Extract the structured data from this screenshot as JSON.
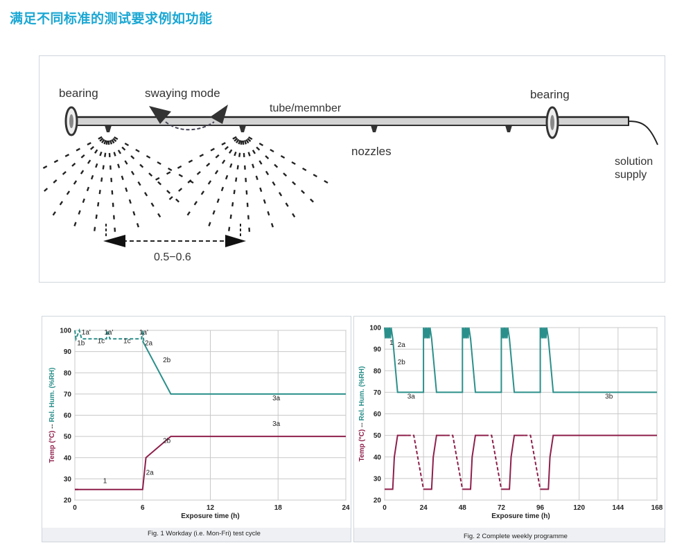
{
  "heading": "满足不同标准的测试要求例如功能",
  "spray_diagram": {
    "labels": {
      "bearing_left": "bearing",
      "swaying": "swaying mode",
      "tube": "tube/memnber",
      "bearing_right": "bearing",
      "nozzles": "nozzles",
      "solution_line1": "solution",
      "solution_line2": "supply",
      "distance": "0.5−0.6"
    }
  },
  "chart_data": [
    {
      "type": "line",
      "caption": "Fig. 1  Workday (i.e. Mon-Fri) test cycle",
      "xlabel": "Exposure time (h)",
      "ylabel_left": "Temp (°C)",
      "ylabel_sep": " -- ",
      "ylabel_right": "Rel. Hum. (%RH)",
      "xlim": [
        0,
        24
      ],
      "ylim": [
        20,
        100
      ],
      "xticks": [
        0,
        6,
        12,
        18,
        24
      ],
      "yticks": [
        20,
        30,
        40,
        50,
        60,
        70,
        80,
        90,
        100
      ],
      "grid": true,
      "colors": {
        "humidity": "#2a8f8a",
        "temperature": "#8e1f4a"
      },
      "series": [
        {
          "name": "",
          "style": "solid",
          "key": "hum",
          "points": [
            [
              6,
              95
            ],
            [
              8.5,
              70
            ],
            [
              24,
              70
            ]
          ]
        },
        {
          "name": "",
          "style": "dashed",
          "key": "hum",
          "points": [
            [
              0,
              100
            ],
            [
              0.1,
              96
            ],
            [
              0.4,
              100
            ],
            [
              0.6,
              96
            ],
            [
              2.8,
              96
            ],
            [
              2.9,
              100
            ],
            [
              3.1,
              96
            ],
            [
              5.9,
              96
            ],
            [
              6,
              100
            ],
            [
              6.1,
              95
            ]
          ]
        },
        {
          "name": "",
          "style": "solid",
          "key": "temp",
          "points": [
            [
              0,
              25
            ],
            [
              6,
              25
            ],
            [
              6.3,
              40
            ],
            [
              8.5,
              50
            ],
            [
              24,
              50
            ]
          ]
        },
        {
          "name": "",
          "style": "dashed",
          "key": "temp",
          "points": [
            [
              0,
              25
            ],
            [
              0.5,
              25
            ]
          ]
        }
      ],
      "annotations": [
        {
          "text": "1a'",
          "x": 0.6,
          "y": 98
        },
        {
          "text": "1b",
          "x": 0.2,
          "y": 93
        },
        {
          "text": "1c",
          "x": 2.0,
          "y": 94
        },
        {
          "text": "1a'",
          "x": 2.6,
          "y": 98
        },
        {
          "text": "1c",
          "x": 4.3,
          "y": 94
        },
        {
          "text": "1a'",
          "x": 5.7,
          "y": 98
        },
        {
          "text": "2a",
          "x": 6.2,
          "y": 93
        },
        {
          "text": "2b",
          "x": 7.8,
          "y": 85
        },
        {
          "text": "3a",
          "x": 17.5,
          "y": 67
        },
        {
          "text": "3a",
          "x": 17.5,
          "y": 55
        },
        {
          "text": "2b",
          "x": 7.8,
          "y": 47
        },
        {
          "text": "2a",
          "x": 6.3,
          "y": 32
        },
        {
          "text": "1",
          "x": 2.5,
          "y": 28
        }
      ]
    },
    {
      "type": "line",
      "caption": "Fig. 2  Complete weekly programme",
      "xlabel": "Exposure time (h)",
      "ylabel_left": "Temp (°C)",
      "ylabel_sep": " -- ",
      "ylabel_right": "Rel. Hum. (%RH)",
      "xlim": [
        0,
        168
      ],
      "ylim": [
        20,
        100
      ],
      "xticks": [
        0,
        24,
        48,
        72,
        96,
        120,
        144,
        168
      ],
      "yticks": [
        20,
        30,
        40,
        50,
        60,
        70,
        80,
        90,
        100
      ],
      "grid": true,
      "colors": {
        "humidity": "#2a8f8a",
        "temperature": "#8e1f4a"
      },
      "series": [
        {
          "name": "",
          "style": "solid",
          "key": "hum",
          "points": [
            [
              0,
              100
            ],
            [
              0.5,
              95
            ],
            [
              1,
              100
            ],
            [
              1.5,
              95
            ],
            [
              2,
              100
            ],
            [
              2.5,
              95
            ],
            [
              3,
              100
            ],
            [
              3.5,
              95
            ],
            [
              4,
              100
            ],
            [
              5,
              95
            ],
            [
              8,
              70
            ],
            [
              24,
              70
            ],
            [
              24,
              100
            ],
            [
              24.5,
              95
            ],
            [
              25,
              100
            ],
            [
              25.5,
              95
            ],
            [
              26,
              100
            ],
            [
              26.5,
              95
            ],
            [
              27,
              100
            ],
            [
              27.5,
              95
            ],
            [
              28,
              100
            ],
            [
              29,
              95
            ],
            [
              32,
              70
            ],
            [
              48,
              70
            ],
            [
              48,
              100
            ],
            [
              48.5,
              95
            ],
            [
              49,
              100
            ],
            [
              49.5,
              95
            ],
            [
              50,
              100
            ],
            [
              50.5,
              95
            ],
            [
              51,
              100
            ],
            [
              51.5,
              95
            ],
            [
              52,
              100
            ],
            [
              53,
              95
            ],
            [
              56,
              70
            ],
            [
              72,
              70
            ],
            [
              72,
              100
            ],
            [
              72.5,
              95
            ],
            [
              73,
              100
            ],
            [
              73.5,
              95
            ],
            [
              74,
              100
            ],
            [
              74.5,
              95
            ],
            [
              75,
              100
            ],
            [
              75.5,
              95
            ],
            [
              76,
              100
            ],
            [
              77,
              95
            ],
            [
              80,
              70
            ],
            [
              96,
              70
            ],
            [
              96,
              100
            ],
            [
              96.5,
              95
            ],
            [
              97,
              100
            ],
            [
              97.5,
              95
            ],
            [
              98,
              100
            ],
            [
              98.5,
              95
            ],
            [
              99,
              100
            ],
            [
              99.5,
              95
            ],
            [
              100,
              100
            ],
            [
              101,
              95
            ],
            [
              104,
              70
            ],
            [
              168,
              70
            ]
          ]
        },
        {
          "name": "",
          "style": "solid",
          "key": "temp",
          "points": [
            [
              0,
              25
            ],
            [
              5,
              25
            ],
            [
              6,
              40
            ],
            [
              8,
              50
            ],
            [
              14,
              50
            ]
          ]
        },
        {
          "name": "",
          "style": "dashed",
          "key": "temp",
          "points": [
            [
              14,
              50
            ],
            [
              18,
              50
            ],
            [
              24,
              25
            ]
          ]
        },
        {
          "name": "",
          "style": "solid",
          "key": "temp",
          "points": [
            [
              24,
              25
            ],
            [
              29,
              25
            ],
            [
              30,
              40
            ],
            [
              32,
              50
            ],
            [
              38,
              50
            ]
          ]
        },
        {
          "name": "",
          "style": "dashed",
          "key": "temp",
          "points": [
            [
              38,
              50
            ],
            [
              42,
              50
            ],
            [
              48,
              25
            ]
          ]
        },
        {
          "name": "",
          "style": "solid",
          "key": "temp",
          "points": [
            [
              48,
              25
            ],
            [
              53,
              25
            ],
            [
              54,
              40
            ],
            [
              56,
              50
            ],
            [
              62,
              50
            ]
          ]
        },
        {
          "name": "",
          "style": "dashed",
          "key": "temp",
          "points": [
            [
              62,
              50
            ],
            [
              66,
              50
            ],
            [
              72,
              25
            ]
          ]
        },
        {
          "name": "",
          "style": "solid",
          "key": "temp",
          "points": [
            [
              72,
              25
            ],
            [
              77,
              25
            ],
            [
              78,
              40
            ],
            [
              80,
              50
            ],
            [
              86,
              50
            ]
          ]
        },
        {
          "name": "",
          "style": "dashed",
          "key": "temp",
          "points": [
            [
              86,
              50
            ],
            [
              90,
              50
            ],
            [
              96,
              25
            ]
          ]
        },
        {
          "name": "",
          "style": "solid",
          "key": "temp",
          "points": [
            [
              96,
              25
            ],
            [
              101,
              25
            ],
            [
              102,
              40
            ],
            [
              104,
              50
            ],
            [
              168,
              50
            ]
          ]
        }
      ],
      "annotations": [
        {
          "text": "1",
          "x": 3,
          "y": 92
        },
        {
          "text": "2a",
          "x": 8,
          "y": 91
        },
        {
          "text": "2b",
          "x": 8,
          "y": 83
        },
        {
          "text": "3a",
          "x": 14,
          "y": 67
        },
        {
          "text": "3b",
          "x": 136,
          "y": 67
        }
      ]
    }
  ]
}
